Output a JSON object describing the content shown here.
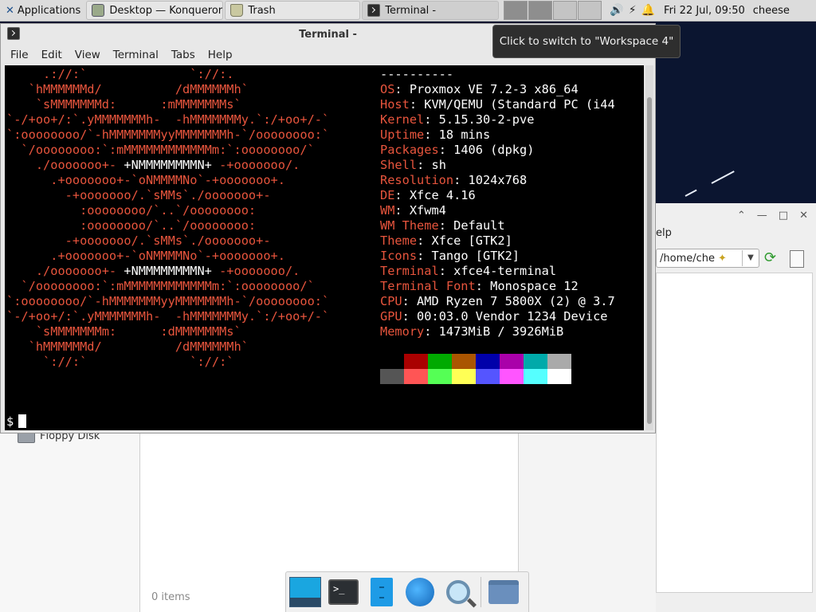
{
  "panel": {
    "applications_label": "Applications",
    "tasks": [
      {
        "label": "Desktop — Konqueror",
        "icon": "konqueror-icon"
      },
      {
        "label": "Trash",
        "icon": "trash-icon"
      },
      {
        "label": "Terminal -",
        "icon": "terminal-icon"
      }
    ],
    "clock": "Fri 22 Jul, 09:50",
    "user": "cheese"
  },
  "tooltip": {
    "text": "Click to switch to \"Workspace 4\""
  },
  "terminal": {
    "title": "Terminal -",
    "menu": [
      "File",
      "Edit",
      "View",
      "Terminal",
      "Tabs",
      "Help"
    ],
    "prompt": "$"
  },
  "neofetch": {
    "separator": "----------",
    "info": [
      {
        "key": "OS",
        "value": "Proxmox VE 7.2-3 x86_64"
      },
      {
        "key": "Host",
        "value": "KVM/QEMU (Standard PC (i44"
      },
      {
        "key": "Kernel",
        "value": "5.15.30-2-pve"
      },
      {
        "key": "Uptime",
        "value": "18 mins"
      },
      {
        "key": "Packages",
        "value": "1406 (dpkg)"
      },
      {
        "key": "Shell",
        "value": "sh"
      },
      {
        "key": "Resolution",
        "value": "1024x768"
      },
      {
        "key": "DE",
        "value": "Xfce 4.16"
      },
      {
        "key": "WM",
        "value": "Xfwm4"
      },
      {
        "key": "WM Theme",
        "value": "Default"
      },
      {
        "key": "Theme",
        "value": "Xfce [GTK2]"
      },
      {
        "key": "Icons",
        "value": "Tango [GTK2]"
      },
      {
        "key": "Terminal",
        "value": "xfce4-terminal"
      },
      {
        "key": "Terminal Font",
        "value": "Monospace 12"
      },
      {
        "key": "CPU",
        "value": "AMD Ryzen 7 5800X (2) @ 3.7"
      },
      {
        "key": "GPU",
        "value": "00:03.0 Vendor 1234 Device"
      },
      {
        "key": "Memory",
        "value": "1473MiB / 3926MiB"
      }
    ],
    "palette_dark": [
      "#000000",
      "#aa0000",
      "#00aa00",
      "#aa5500",
      "#0000aa",
      "#aa00aa",
      "#00aaaa",
      "#aaaaaa"
    ],
    "palette_bright": [
      "#555555",
      "#ff5555",
      "#55ff55",
      "#ffff55",
      "#5555ff",
      "#ff55ff",
      "#55ffff",
      "#ffffff"
    ],
    "logo_color": "#e8553d"
  },
  "file_manager": {
    "sidebar_item": "Floppy Disk",
    "status": "0 items",
    "menu_fragment": "elp",
    "path": "/home/che"
  },
  "dock": [
    "desktop-icon",
    "terminal-icon",
    "file-cabinet-icon",
    "web-browser-icon",
    "search-icon",
    "folder-icon"
  ]
}
